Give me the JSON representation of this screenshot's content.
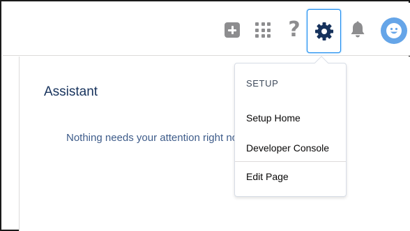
{
  "header": {
    "icons": [
      "add-icon",
      "app-launcher-icon",
      "help-icon",
      "gear-icon",
      "bell-icon",
      "avatar-smiley-icon"
    ]
  },
  "colors": {
    "icon_gray": "#8d8d8f",
    "setup_active_border": "#1589ee",
    "gear_dark": "#16325c",
    "avatar_bg": "#65a5e8",
    "title_navy": "#16325c"
  },
  "assistant": {
    "title": "Assistant",
    "message": "Nothing needs your attention right now. Check back later."
  },
  "setup_menu": {
    "heading": "SETUP",
    "items": [
      "Setup Home",
      "Developer Console",
      "Edit Page"
    ]
  }
}
